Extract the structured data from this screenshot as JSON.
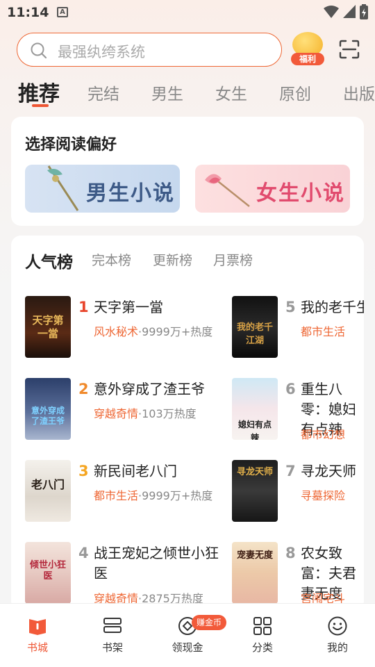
{
  "status_bar": {
    "time": "11:14",
    "notification_letter": "A"
  },
  "search": {
    "placeholder": "最强纨绔系统"
  },
  "welfare": {
    "label": "福利"
  },
  "tabs": [
    {
      "label": "推荐",
      "active": true
    },
    {
      "label": "完结"
    },
    {
      "label": "男生"
    },
    {
      "label": "女生"
    },
    {
      "label": "原创"
    },
    {
      "label": "出版"
    }
  ],
  "preference": {
    "title": "选择阅读偏好",
    "male": "男生小说",
    "female": "女生小说"
  },
  "ranking": {
    "tabs": [
      {
        "label": "人气榜",
        "active": true
      },
      {
        "label": "完本榜"
      },
      {
        "label": "更新榜"
      },
      {
        "label": "月票榜"
      }
    ],
    "books": [
      {
        "rank": "1",
        "title": "天字第一當",
        "genre": "风水秘术",
        "heat": "·9999万+热度",
        "cover_text": "天字第一當",
        "rank_color": "#e8452c"
      },
      {
        "rank": "2",
        "title": "意外穿成了渣王爷",
        "genre": "穿越奇情",
        "heat": "·103万热度",
        "cover_text": "意外穿成了渣王爷",
        "rank_color": "#f08a2c"
      },
      {
        "rank": "3",
        "title": "新民间老八门",
        "genre": "都市生活",
        "heat": "·9999万+热度",
        "cover_text": "老八门",
        "rank_color": "#f5a623"
      },
      {
        "rank": "4",
        "title": "战王宠妃之倾世小狂医",
        "genre": "穿越奇情",
        "heat": "·2875万热度",
        "cover_text": "倾世小狂医",
        "rank_color": "#999999"
      },
      {
        "rank": "5",
        "title": "我的老千生涯",
        "genre": "都市生活",
        "heat": "",
        "cover_text": "我的老千江湖",
        "rank_color": "#999999"
      },
      {
        "rank": "6",
        "title": "重生八零：媳妇有点辣",
        "genre": "都市幻想",
        "heat": "",
        "cover_text": "媳妇有点辣",
        "rank_color": "#999999"
      },
      {
        "rank": "7",
        "title": "寻龙天师",
        "genre": "寻墓探险",
        "heat": "",
        "cover_text": "寻龙天师",
        "rank_color": "#999999"
      },
      {
        "rank": "8",
        "title": "农女致富：夫君妻无度",
        "genre": "宫闱宅斗",
        "heat": "",
        "cover_text": "宠妻无度",
        "rank_color": "#999999"
      }
    ]
  },
  "bottom_nav": [
    {
      "label": "书城",
      "active": true
    },
    {
      "label": "书架"
    },
    {
      "label": "领现金"
    },
    {
      "label": "分类"
    },
    {
      "label": "我的"
    }
  ],
  "earn_badge": "赚金币",
  "colors": {
    "accent": "#ee5533",
    "genre": "#ee6633"
  }
}
